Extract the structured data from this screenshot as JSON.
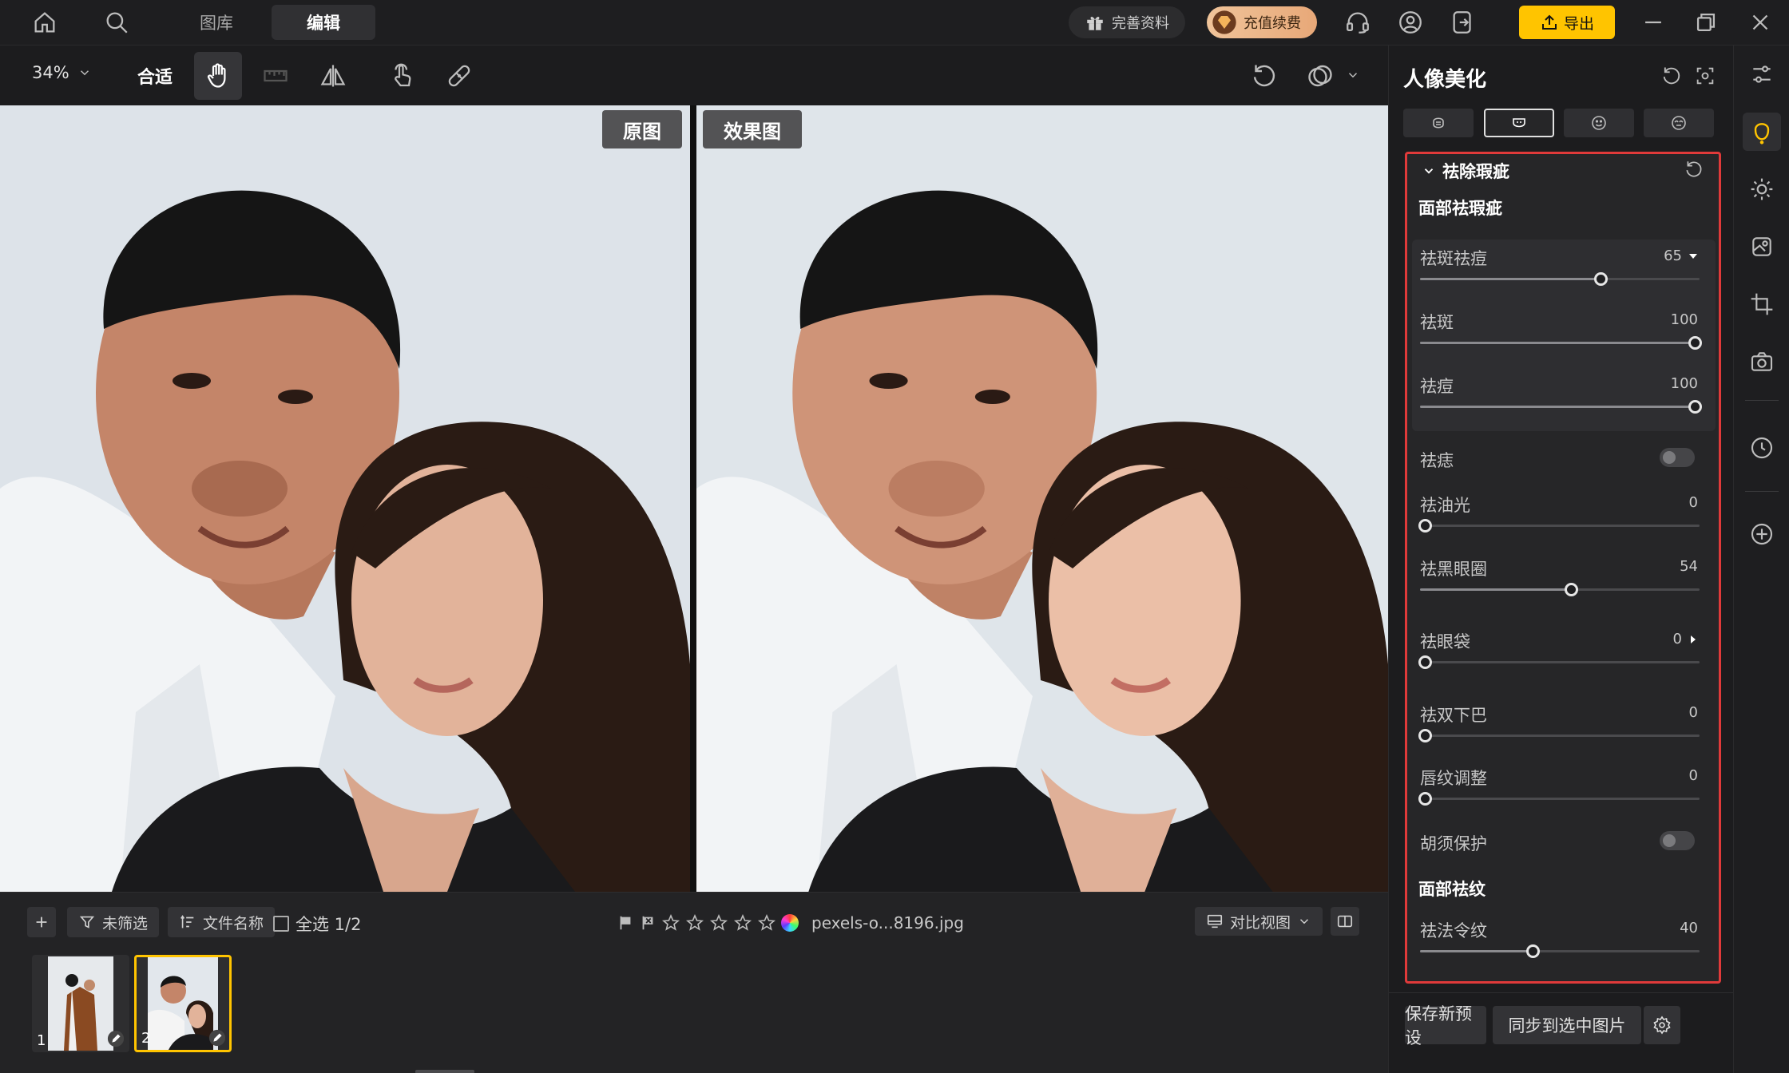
{
  "nav": {
    "tab_library": "图库",
    "tab_edit": "编辑",
    "complete_info": "完善资料",
    "recharge": "充值续费",
    "export": "导出"
  },
  "toolbar": {
    "zoom": "34%",
    "fit": "合适"
  },
  "canvas": {
    "label_original": "原图",
    "label_result": "效果图"
  },
  "bottom": {
    "filter": "未筛选",
    "sort_by": "文件名称",
    "select_all": "全选 1/2",
    "filename": "pexels-o...8196.jpg",
    "view_mode": "对比视图",
    "thumbnails": [
      {
        "num": "1"
      },
      {
        "num": "2"
      }
    ]
  },
  "panel": {
    "title": "人像美化",
    "section_title": "祛除瑕疵",
    "sub_face_blemish": "面部祛瑕疵",
    "sub_face_wrinkle": "面部祛纹",
    "sliders": {
      "spot_acne": {
        "label": "祛斑祛痘",
        "value": "65",
        "level": 65
      },
      "spot": {
        "label": "祛斑",
        "value": "100",
        "level": 100
      },
      "acne": {
        "label": "祛痘",
        "value": "100",
        "level": 100
      },
      "oil": {
        "label": "祛油光",
        "value": "0",
        "level": 0
      },
      "dark_circle": {
        "label": "祛黑眼圈",
        "value": "54",
        "level": 54
      },
      "eye_bag": {
        "label": "祛眼袋",
        "value": "0",
        "level": 0
      },
      "double_chin": {
        "label": "祛双下巴",
        "value": "0",
        "level": 0
      },
      "lip_lines": {
        "label": "唇纹调整",
        "value": "0",
        "level": 0
      },
      "nasolabial": {
        "label": "祛法令纹",
        "value": "40",
        "level": 40
      }
    },
    "toggles": {
      "mole": {
        "label": "祛痣",
        "on": false
      },
      "beard": {
        "label": "胡须保护",
        "on": false
      }
    },
    "save_preset": "保存新预设",
    "sync_selected": "同步到选中图片"
  },
  "colors": {
    "accent": "#ffc400",
    "highlight_border": "#e03a3a",
    "panel_bg": "#1c1c1e"
  }
}
